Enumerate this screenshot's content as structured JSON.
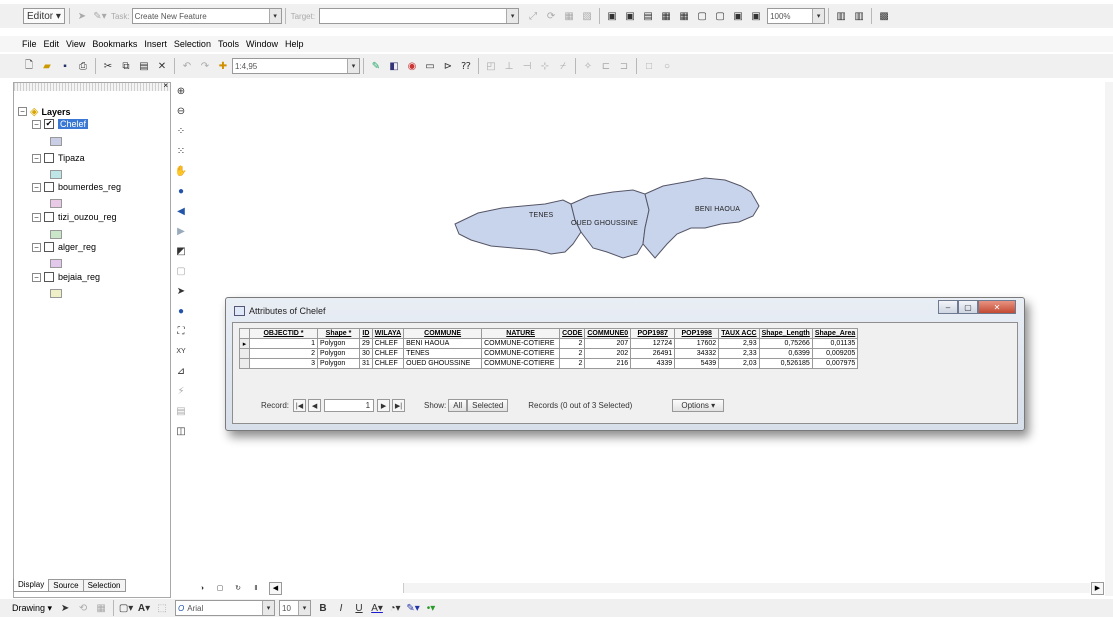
{
  "editor_bar": {
    "editor_label": "Editor",
    "task_label": "Task:",
    "task_value": "Create New Feature",
    "target_label": "Target:",
    "zoom_value": "100%"
  },
  "menu": [
    "File",
    "Edit",
    "View",
    "Bookmarks",
    "Insert",
    "Selection",
    "Tools",
    "Window",
    "Help"
  ],
  "standard_bar": {
    "scale_value": "1:4,95"
  },
  "toc": {
    "root_label": "Layers",
    "layers": [
      {
        "name": "Chelef",
        "checked": true,
        "color": "#c9cde6"
      },
      {
        "name": "Tipaza",
        "checked": false,
        "color": "#bfe6e6"
      },
      {
        "name": "boumerdes_reg",
        "checked": false,
        "color": "#e8c9e6"
      },
      {
        "name": "tizi_ouzou_reg",
        "checked": false,
        "color": "#c9e6c9"
      },
      {
        "name": "alger_reg",
        "checked": false,
        "color": "#e2c9ec"
      },
      {
        "name": "bejaia_reg",
        "checked": false,
        "color": "#f0f0c8"
      }
    ],
    "tabs": [
      "Display",
      "Source",
      "Selection"
    ]
  },
  "map": {
    "labels": [
      "TENES",
      "OUED GHOUSSINE",
      "BENI HAOUA"
    ],
    "fill_color": "#c8d4ec"
  },
  "attributes": {
    "title": "Attributes of Chelef",
    "columns": [
      "OBJECTID *",
      "Shape *",
      "ID",
      "WILAYA",
      "COMMUNE",
      "NATURE",
      "CODE",
      "COMMUNE0",
      "POP1987",
      "POP1998",
      "TAUX ACC",
      "Shape_Length",
      "Shape_Area"
    ],
    "rows": [
      [
        "1",
        "Polygon",
        "29",
        "CHLEF",
        "BENI HAOUA",
        "COMMUNE-COTIERE",
        "2",
        "207",
        "12724",
        "17602",
        "2,93",
        "0,75266",
        "0,01135"
      ],
      [
        "2",
        "Polygon",
        "30",
        "CHLEF",
        "TENES",
        "COMMUNE-COTIERE",
        "2",
        "202",
        "26491",
        "34332",
        "2,33",
        "0,6399",
        "0,009205"
      ],
      [
        "3",
        "Polygon",
        "31",
        "CHLEF",
        "OUED GHOUSSINE",
        "COMMUNE-COTIERE",
        "2",
        "216",
        "4339",
        "5439",
        "2,03",
        "0,526185",
        "0,007975"
      ]
    ],
    "record_label": "Record:",
    "record_value": "1",
    "show_label": "Show:",
    "show_all": "All",
    "show_selected": "Selected",
    "records_status": "Records (0 out of 3 Selected)",
    "options_label": "Options"
  },
  "drawing_bar": {
    "drawing_label": "Drawing",
    "font_name": "Arial",
    "font_size": "10"
  }
}
